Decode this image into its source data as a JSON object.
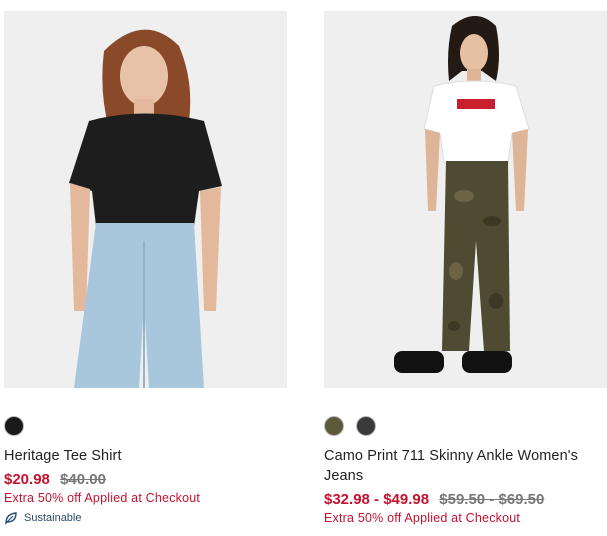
{
  "products": [
    {
      "name": "Heritage Tee Shirt",
      "image_alt": "Woman in black t-shirt and light blue jeans",
      "swatches": [
        {
          "name": "black",
          "color": "#1a1a1a"
        }
      ],
      "sale_price": "$20.98",
      "original_price": "$40.00",
      "promo": "Extra 50% off Applied at Checkout",
      "badge": "Sustainable"
    },
    {
      "name": "Camo Print 711 Skinny Ankle Women's Jeans",
      "image_alt": "Woman in white Levi's t-shirt and camo skinny jeans",
      "swatches": [
        {
          "name": "camo-green",
          "color": "#5c5a3a"
        },
        {
          "name": "camo-black",
          "color": "#3a3a3a"
        }
      ],
      "sale_price": "$32.98 - $49.98",
      "original_price": "$59.50 - $69.50",
      "promo": "Extra 50% off Applied at Checkout"
    }
  ],
  "colors": {
    "sale": "#c41230",
    "strike": "#777777",
    "sustainable": "#2a4d6b",
    "image_bg": "#efefef"
  }
}
